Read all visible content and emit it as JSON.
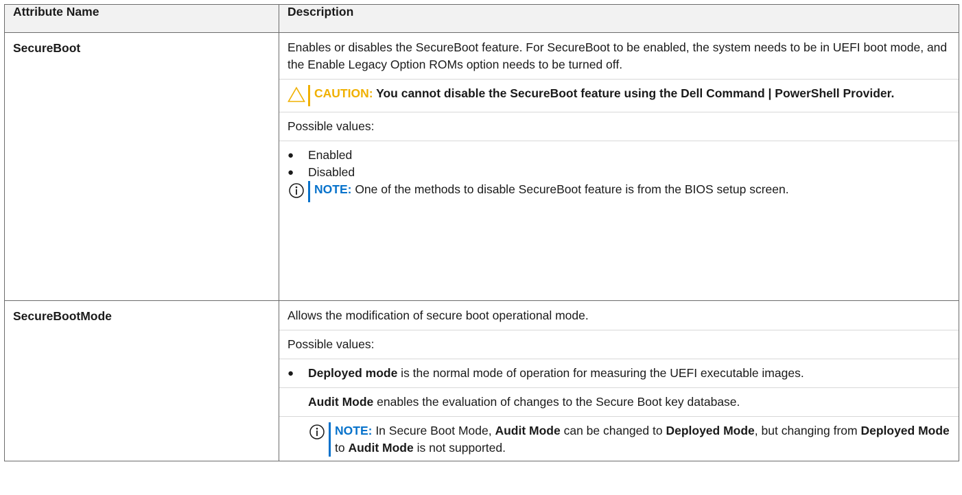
{
  "table": {
    "header": {
      "col1": "Attribute Name",
      "col2": "Description"
    },
    "row1": {
      "name": "SecureBoot",
      "desc": "Enables or disables the SecureBoot feature. For SecureBoot to be enabled, the system needs to be in UEFI boot mode, and the Enable Legacy Option ROMs option needs to be turned off.",
      "caution_label": "CAUTION:",
      "caution_text": " You cannot disable the SecureBoot feature using the Dell Command | PowerShell Provider.",
      "possible_values": "Possible values:",
      "values": [
        "Enabled",
        "Disabled"
      ],
      "note_label": "NOTE:",
      "note_text": " One of the methods to disable SecureBoot feature is from the BIOS setup screen."
    },
    "row2": {
      "name": "SecureBootMode",
      "desc": "Allows the modification of secure boot operational mode.",
      "possible_values": "Possible values:",
      "bullet_bold": "Deployed mode",
      "bullet_text": " is the normal mode of operation for measuring the UEFI executable images.",
      "audit_bold": "Audit Mode",
      "audit_text": " enables the evaluation of changes to the Secure Boot key database.",
      "note_label": "NOTE:",
      "note_t1": " In Secure Boot Mode, ",
      "note_b1": "Audit Mode",
      "note_t2": " can be changed to ",
      "note_b2": "Deployed Mode",
      "note_t3": ", but changing from ",
      "note_b3": "Deployed Mode",
      "note_t4": " to ",
      "note_b4": "Audit Mode",
      "note_t5": " is not supported."
    }
  },
  "icons": {
    "caution": "caution-triangle-icon",
    "note": "info-circle-icon",
    "note_color": "#0672cb",
    "caution_color": "#f0b000"
  }
}
